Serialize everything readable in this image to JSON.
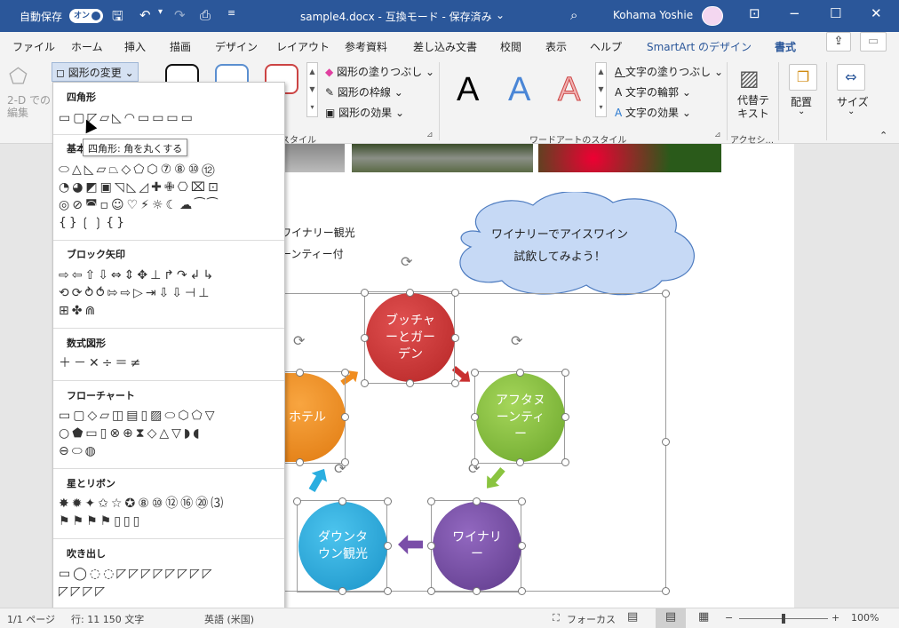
{
  "titlebar": {
    "autosave_label": "自動保存",
    "autosave_state": "オン",
    "doc_title": "sample4.docx - 互換モード - 保存済み",
    "user_name": "Kohama Yoshie",
    "caret": "⌄"
  },
  "ribbon_tabs": [
    "ファイル",
    "ホーム",
    "挿入",
    "描画",
    "デザイン",
    "レイアウト",
    "参考資料",
    "差し込み文書",
    "校閲",
    "表示",
    "ヘルプ",
    "SmartArt のデザイン",
    "書式"
  ],
  "ribbon": {
    "convert_2d": "2-D での\n編集",
    "change_shape": "図形の変更",
    "shape_fill": "図形の塗りつぶし",
    "shape_outline": "図形の枠線",
    "shape_effects": "図形の効果",
    "style_group": "スタイル",
    "wordart_group": "ワードアートのスタイル",
    "text_fill": "文字の塗りつぶし",
    "text_outline": "文字の輪郭",
    "text_effects": "文字の効果",
    "wordart_letter": "A",
    "alt_text": "代替テキスト",
    "accessibility_group": "アクセシ...",
    "arrange": "配置",
    "size": "サイズ"
  },
  "shape_menu": {
    "sections": [
      {
        "title": "四角形",
        "rows": [
          "▭▢◸▱◺◠▭▭▭▭"
        ]
      },
      {
        "title": "基本図形",
        "rows": [
          "⬭△◺▱⏢◇⬠⬡⑦⑧⑩⑫",
          "◔◕◩▣◹◺◿✚✙⎔⌧⊡",
          "◎⊘◚▫☺♡⚡☼☾☁⁀⁀",
          "{}❲❳{}"
        ]
      },
      {
        "title": "ブロック矢印",
        "rows": [
          "⇨⇦⇧⇩⇔⇕✥⊥↱↷↲↳",
          "⟲⟳⥁⥀⇰⇨▷⇥⇩⇩⊣⊥",
          "⊞✤⋒"
        ]
      },
      {
        "title": "数式図形",
        "rows": [
          "＋－✕÷＝≠"
        ]
      },
      {
        "title": "フローチャート",
        "rows": [
          "▭▢◇▱◫▤▯▨⬭⬡⬠▽",
          "○⬟▭▯⊗⊕⧗◇△▽◗◖",
          "⊖⬭◍"
        ]
      },
      {
        "title": "星とリボン",
        "rows": [
          "✸✹✦✩☆✪⑧⑩⑫⑯⑳⑶",
          "⚑⚑⚑⚑▯▯▯"
        ]
      },
      {
        "title": "吹き出し",
        "rows": [
          "▭◯◌◌◸◸◸◸◸◸◸◸",
          "◸◸◸◸"
        ]
      }
    ],
    "tooltip": "四角形: 角を丸くする"
  },
  "document": {
    "line1": "ワイナリー観光",
    "line2": "ーンティー付",
    "cloud_text_1": "ワイナリーでアイスワイン",
    "cloud_text_2": "試飲してみよう！",
    "nodes": {
      "butcher": "ブッチャ\nーとガー\nデン",
      "hotel": "ホテル",
      "afternoon": "アフタヌ\nーンティ\nー",
      "downtown": "ダウンタ\nウン観光",
      "winery": "ワイナリ\nー"
    }
  },
  "statusbar": {
    "page": "1/1 ページ",
    "chars": "行: 11   150 文字",
    "lang": "英語 (米国)",
    "focus": "フォーカス",
    "zoom": "100%",
    "minus": "−",
    "plus": "+"
  },
  "colors": {
    "accent": "#2b579a",
    "red": "#d23a3a",
    "orange": "#f08c1e",
    "green": "#8ac43f",
    "blue": "#2aaee0",
    "purple": "#7a4ea8"
  }
}
